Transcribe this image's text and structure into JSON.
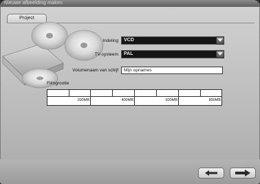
{
  "window": {
    "title": "Nieuwe afbeelding maken"
  },
  "tabs": [
    {
      "label": "Project"
    }
  ],
  "form": {
    "layout_label": "Indeling",
    "layout_value": "VCD",
    "tvsystem_label": "TV-systeem",
    "tvsystem_value": "PAL",
    "volumename_label": "Volumenaam van schijf",
    "volumename_value": "Mijn opnames"
  },
  "filesize": {
    "label": "Filmgrootte",
    "ticks": [
      "200MB",
      "400MB",
      "600MB",
      "800MB"
    ]
  },
  "nav": {
    "back_icon": "arrow-left-icon",
    "next_icon": "arrow-right-icon"
  },
  "colors": {
    "window_bg": "#c4c4c4",
    "combo_bg": "#151515",
    "combo_text": "#f0f0f0"
  }
}
